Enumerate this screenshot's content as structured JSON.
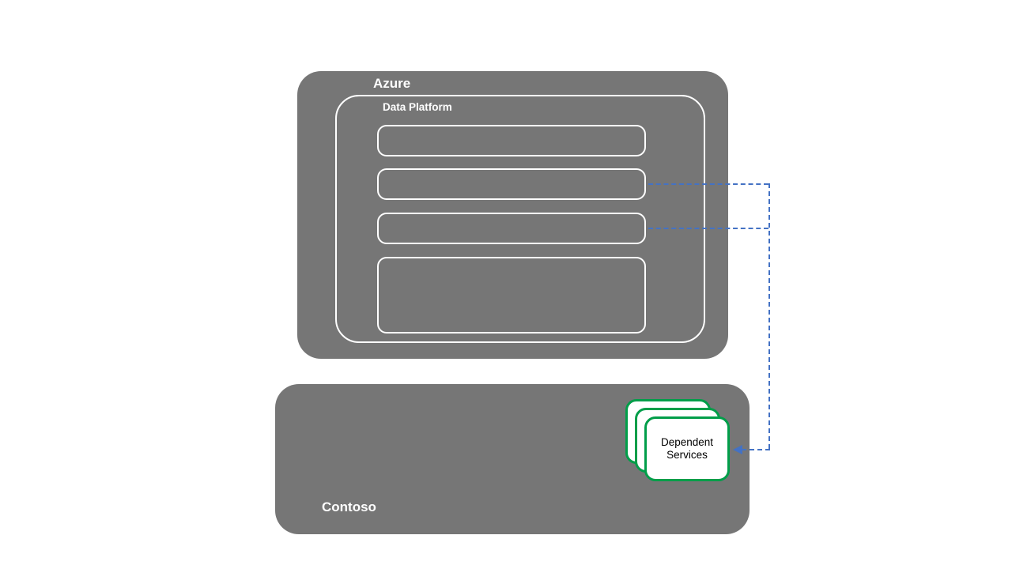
{
  "diagram": {
    "azure_label": "Azure",
    "data_platform_label": "Data Platform",
    "contoso_label": "Contoso",
    "dependent_services_text": "Dependent Services"
  },
  "colors": {
    "container_gray": "#767676",
    "outline_white": "#ffffff",
    "service_green": "#009e49",
    "connector_blue": "#4472c4"
  }
}
